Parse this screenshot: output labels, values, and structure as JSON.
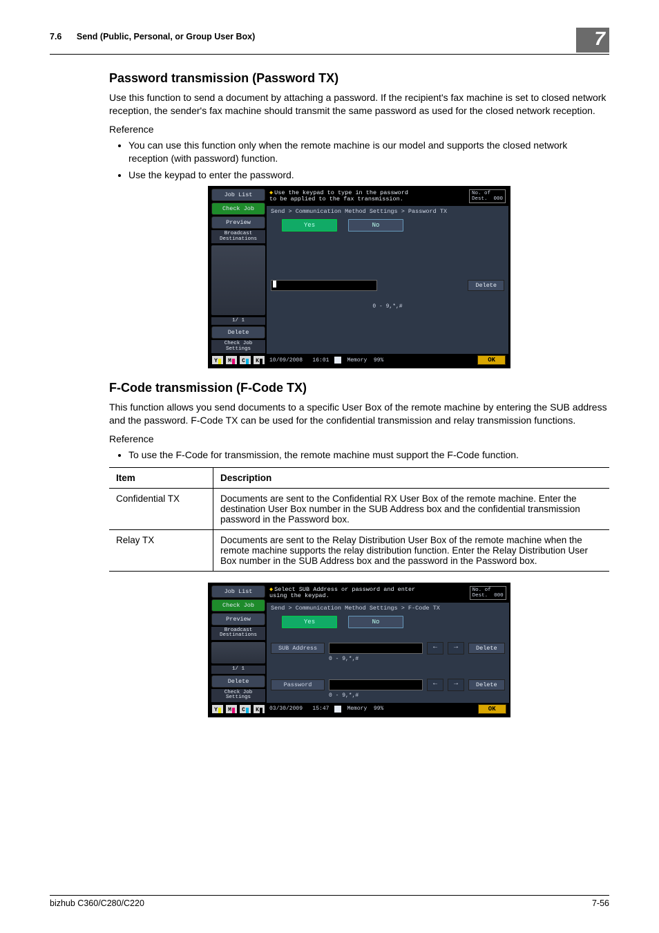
{
  "header": {
    "section_number": "7.6",
    "section_title": "Send (Public, Personal, or Group User Box)",
    "chapter_number": "7"
  },
  "s1": {
    "heading": "Password transmission (Password TX)",
    "para": "Use this function to send a document by attaching a password. If the recipient's fax machine is set to closed network reception, the sender's fax machine should transmit the same password as used for the closed network reception.",
    "reference": "Reference",
    "bullets": [
      "You can use this function only when the remote machine is our model and supports the closed network reception (with password) function.",
      "Use the keypad to enter the password."
    ]
  },
  "ui1": {
    "side": {
      "job_list": "Job List",
      "check_job": "Check Job",
      "preview": "Preview",
      "broadcast": "Broadcast\nDestinations",
      "pager": "1/  1",
      "delete": "Delete",
      "check_settings": "Check Job\nSettings",
      "toners": [
        "Y",
        "M",
        "C",
        "K"
      ]
    },
    "hint": "Use the keypad to type in the password\nto be applied to the fax transmission.",
    "dest_label": "No. of\nDest.",
    "dest_count": "000",
    "crumb": "Send > Communication Method Settings > Password TX",
    "yes": "Yes",
    "no": "No",
    "delete": "Delete",
    "legend": "0 - 9,*,#",
    "status": {
      "date": "10/09/2008",
      "time": "16:01",
      "mem_label": "Memory",
      "mem_pct": "99%",
      "ok": "OK"
    }
  },
  "s2": {
    "heading": "F-Code transmission (F-Code TX)",
    "para": "This function allows you send documents to a specific User Box of the remote machine by entering the SUB address and the password. F-Code TX can be used for the confidential transmission and relay transmission functions.",
    "reference": "Reference",
    "bullets": [
      "To use the F-Code for transmission, the remote machine must support the F-Code function."
    ]
  },
  "table": {
    "head_item": "Item",
    "head_desc": "Description",
    "rows": [
      {
        "item": "Confidential TX",
        "desc": "Documents are sent to the Confidential RX User Box of the remote machine. Enter the destination User Box number in the SUB Address box and the confidential transmission password in the Password box."
      },
      {
        "item": "Relay TX",
        "desc": "Documents are sent to the Relay Distribution User Box of the remote machine when the remote machine supports the relay distribution function. Enter the Relay Distribution User Box number in the SUB Address box and the password in the Password box."
      }
    ]
  },
  "ui2": {
    "hint": "Select SUB Address or password and enter\nusing the keypad.",
    "dest_label": "No. of\nDest.",
    "dest_count": "000",
    "crumb": "Send > Communication Method Settings > F-Code TX",
    "yes": "Yes",
    "no": "No",
    "sub_label": "SUB Address",
    "pw_label": "Password",
    "delete": "Delete",
    "legend": "0 - 9,*,#",
    "status": {
      "date": "03/30/2009",
      "time": "15:47",
      "mem_label": "Memory",
      "mem_pct": "99%",
      "ok": "OK"
    }
  },
  "footer": {
    "model": "bizhub C360/C280/C220",
    "page": "7-56"
  }
}
